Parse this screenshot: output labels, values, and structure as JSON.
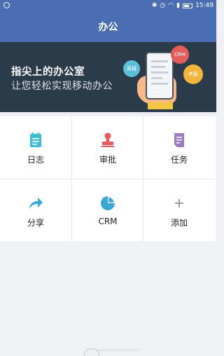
{
  "statusbar": {
    "time": "15:49"
  },
  "navbar": {
    "title": "办公"
  },
  "banner": {
    "headline": "指尖上的办公室",
    "subline": "让您轻松实现移动办公",
    "bubbles": {
      "weekly": "周报",
      "crm": "CRM",
      "attendance": "考勤"
    }
  },
  "grid": {
    "items": [
      {
        "label": "日志",
        "icon": "notebook-icon",
        "color": "#3cbfd6"
      },
      {
        "label": "审批",
        "icon": "stamp-icon",
        "color": "#e35a5a"
      },
      {
        "label": "任务",
        "icon": "task-doc-icon",
        "color": "#9b7cc2"
      },
      {
        "label": "分享",
        "icon": "share-arrow-icon",
        "color": "#3aa7d7"
      },
      {
        "label": "CRM",
        "icon": "pie-chart-icon",
        "color": "#3aa7d7"
      },
      {
        "label": "添加",
        "icon": "plus-icon",
        "color": "#888888"
      }
    ]
  }
}
